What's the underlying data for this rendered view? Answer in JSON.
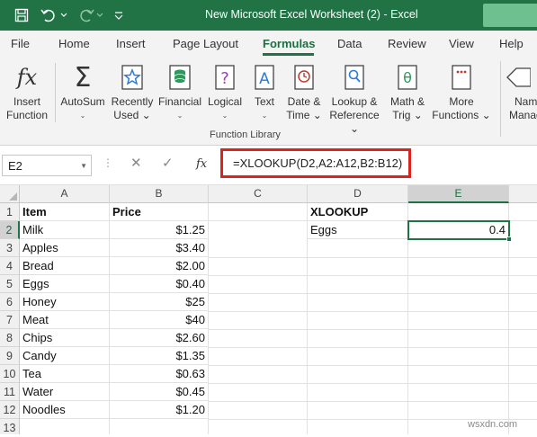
{
  "titlebar": {
    "title": "New Microsoft Excel Worksheet (2)  -  Excel",
    "bg_color": "#217346"
  },
  "tabs": [
    {
      "label": "File"
    },
    {
      "label": "Home"
    },
    {
      "label": "Insert"
    },
    {
      "label": "Page Layout"
    },
    {
      "label": "Formulas",
      "active": true
    },
    {
      "label": "Data"
    },
    {
      "label": "Review"
    },
    {
      "label": "View"
    },
    {
      "label": "Help"
    }
  ],
  "ribbon": {
    "buttons": [
      {
        "line1": "Insert",
        "line2": "Function",
        "icon": "fx-icon"
      },
      {
        "line1": "AutoSum",
        "line2": "⌄",
        "icon": "sigma-icon"
      },
      {
        "line1": "Recently",
        "line2": "Used ⌄",
        "icon": "star-icon"
      },
      {
        "line1": "Financial",
        "line2": "⌄",
        "icon": "coins-icon"
      },
      {
        "line1": "Logical",
        "line2": "⌄",
        "icon": "question-book-icon"
      },
      {
        "line1": "Text",
        "line2": "⌄",
        "icon": "text-book-icon"
      },
      {
        "line1": "Date &",
        "line2": "Time ⌄",
        "icon": "clock-book-icon"
      },
      {
        "line1": "Lookup &",
        "line2": "Reference ⌄",
        "icon": "magnifier-book-icon"
      },
      {
        "line1": "Math &",
        "line2": "Trig ⌄",
        "icon": "theta-book-icon"
      },
      {
        "line1": "More",
        "line2": "Functions ⌄",
        "icon": "more-book-icon"
      },
      {
        "line1": "Nam",
        "line2": "Manag",
        "icon": "tag-icon"
      }
    ],
    "group_label": "Function Library"
  },
  "formula_bar": {
    "name_box": "E2",
    "formula": "=XLOOKUP(D2,A2:A12,B2:B12)",
    "fx_label": "fx"
  },
  "columns": [
    "A",
    "B",
    "C",
    "D",
    "E"
  ],
  "selected_column": "E",
  "rows": [
    "1",
    "2",
    "3",
    "4",
    "5",
    "6",
    "7",
    "8",
    "9",
    "10",
    "11",
    "12",
    "13"
  ],
  "selected_row": "2",
  "sheet": {
    "header": {
      "item": "Item",
      "price": "Price",
      "lookup_title": "XLOOKUP"
    },
    "items": [
      {
        "item": "Milk",
        "price": "$1.25"
      },
      {
        "item": "Apples",
        "price": "$3.40"
      },
      {
        "item": "Bread",
        "price": "$2.00"
      },
      {
        "item": "Eggs",
        "price": "$0.40"
      },
      {
        "item": "Honey",
        "price": "$25"
      },
      {
        "item": "Meat",
        "price": "$40"
      },
      {
        "item": "Chips",
        "price": "$2.60"
      },
      {
        "item": "Candy",
        "price": "$1.35"
      },
      {
        "item": "Tea",
        "price": "$0.63"
      },
      {
        "item": "Water",
        "price": "$0.45"
      },
      {
        "item": "Noodles",
        "price": "$1.20"
      }
    ],
    "lookup_value": "Eggs",
    "lookup_result": "0.4"
  },
  "watermark": "wsxdn.com"
}
